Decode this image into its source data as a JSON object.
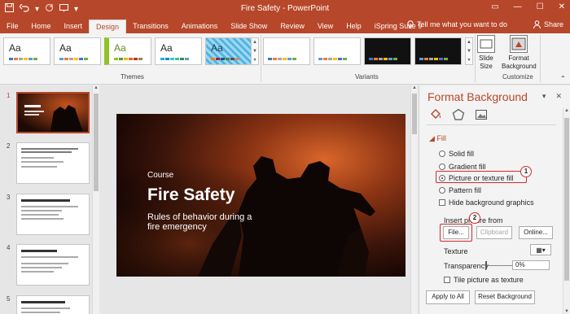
{
  "title": "Fire Safety  -  PowerPoint",
  "tabs": [
    "File",
    "Home",
    "Insert",
    "Design",
    "Transitions",
    "Animations",
    "Slide Show",
    "Review",
    "View",
    "Help",
    "iSpring Suite 9"
  ],
  "active_tab": "Design",
  "tell_me": "Tell me what you want to do",
  "share": "Share",
  "ribbon": {
    "themes_label": "Themes",
    "variants_label": "Variants",
    "customize_label": "Customize",
    "theme_sample": "Aa",
    "slide_size": "Slide Size",
    "format_background": "Format Background"
  },
  "slides": [
    {
      "num": "1"
    },
    {
      "num": "2",
      "heading": "Imagine the situation: ..."
    },
    {
      "num": "3",
      "heading": "Step 1.  Analyze the Situation."
    },
    {
      "num": "4",
      "heading": "Step 2.  Call 9-1-1"
    },
    {
      "num": "5",
      "heading": "Step 3.  Take Measures"
    }
  ],
  "slide": {
    "course": "Course",
    "title": "Fire Safety",
    "subtitle": "Rules of behavior during a fire emergency"
  },
  "format_pane": {
    "title": "Format Background",
    "section": "Fill",
    "fill_options": [
      "Solid fill",
      "Gradient fill",
      "Picture or texture fill",
      "Pattern fill"
    ],
    "selected_fill": "Picture or texture fill",
    "hide_graphics": "Hide background graphics",
    "insert_from": "Insert picture from",
    "file_btn": "File...",
    "clipboard_btn": "Clipboard",
    "online_btn": "Online...",
    "texture": "Texture",
    "transparency": "Transparency",
    "transparency_value": "0%",
    "tile": "Tile picture as texture",
    "apply_all": "Apply to All",
    "reset": "Reset Background",
    "callout1": "1",
    "callout2": "2"
  }
}
